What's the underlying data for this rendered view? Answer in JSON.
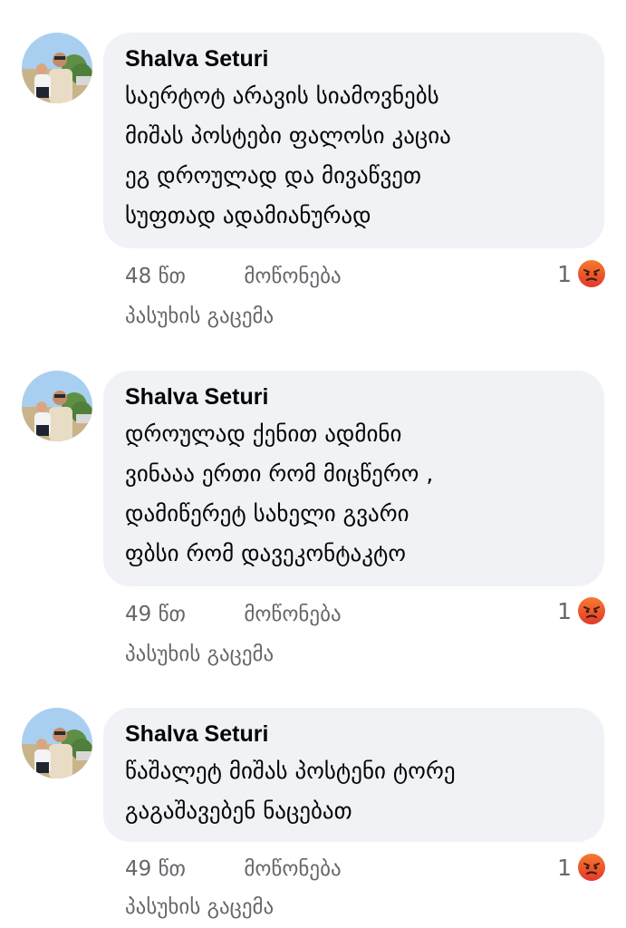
{
  "comments": [
    {
      "author": "Shalva Seturi",
      "lines": [
        "საერტოტ არავის სიამოვნებს",
        "მიშას პოსტები ფალოსი კაცია",
        "ეგ დროულად და მივაწვეთ",
        "სუფთად ადამიანურად"
      ],
      "time": "48 წთ",
      "like": "მოწონება",
      "reply": "პასუხის გაცემა",
      "reaction_count": "1",
      "reaction_icon": "angry-face-icon"
    },
    {
      "author": "Shalva Seturi",
      "lines": [
        "დროულად ქენით ადმინი",
        "ვინააა ერთი რომ მიცწერო ,",
        "დამიწერეტ სახელი გვარი",
        "ფბსი რომ დავეკონტაკტო"
      ],
      "time": "49 წთ",
      "like": "მოწონება",
      "reply": "პასუხის გაცემა",
      "reaction_count": "1",
      "reaction_icon": "angry-face-icon"
    },
    {
      "author": "Shalva Seturi",
      "lines": [
        "წაშალეტ მიშას პოსტენი ტორე",
        "გაგაშავებენ ნაცებათ"
      ],
      "time": "49 წთ",
      "like": "მოწონება",
      "reply": "პასუხის გაცემა",
      "reaction_count": "1",
      "reaction_icon": "angry-face-icon"
    }
  ],
  "colors": {
    "bubble": "#f0f2f5",
    "text": "#050505",
    "meta": "#65676b",
    "angry_top": "#f57b2e",
    "angry_bottom": "#e2392b"
  }
}
